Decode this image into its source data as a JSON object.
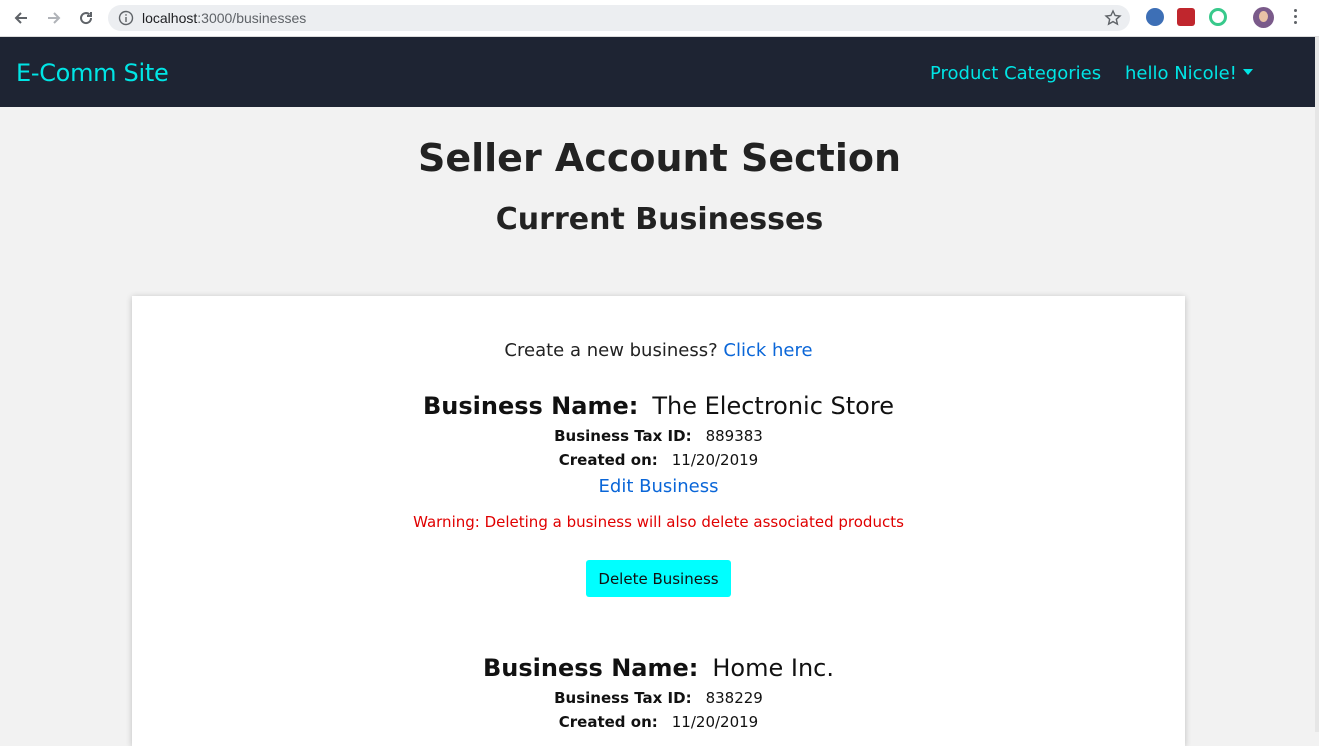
{
  "browser": {
    "url_host": "localhost",
    "url_path": ":3000/businesses"
  },
  "nav": {
    "brand": "E-Comm Site",
    "product_categories": "Product Categories",
    "user_greeting": "hello Nicole!"
  },
  "page": {
    "title": "Seller Account Section",
    "subtitle": "Current Businesses"
  },
  "create": {
    "prompt": "Create a new business?",
    "link": "Click here"
  },
  "labels": {
    "business_name": "Business Name:",
    "tax_id": "Business Tax ID:",
    "created_on": "Created on:",
    "edit": "Edit Business",
    "warning": "Warning: Deleting a business will also delete associated products",
    "delete": "Delete Business"
  },
  "businesses": [
    {
      "name": "The Electronic Store",
      "tax_id": "889383",
      "created": "11/20/2019"
    },
    {
      "name": "Home Inc.",
      "tax_id": "838229",
      "created": "11/20/2019"
    }
  ],
  "colors": {
    "nav_bg": "#1e2433",
    "accent": "#00e5e5",
    "button_bg": "#00ffff",
    "link": "#0a66d8",
    "warning": "#e00000"
  }
}
